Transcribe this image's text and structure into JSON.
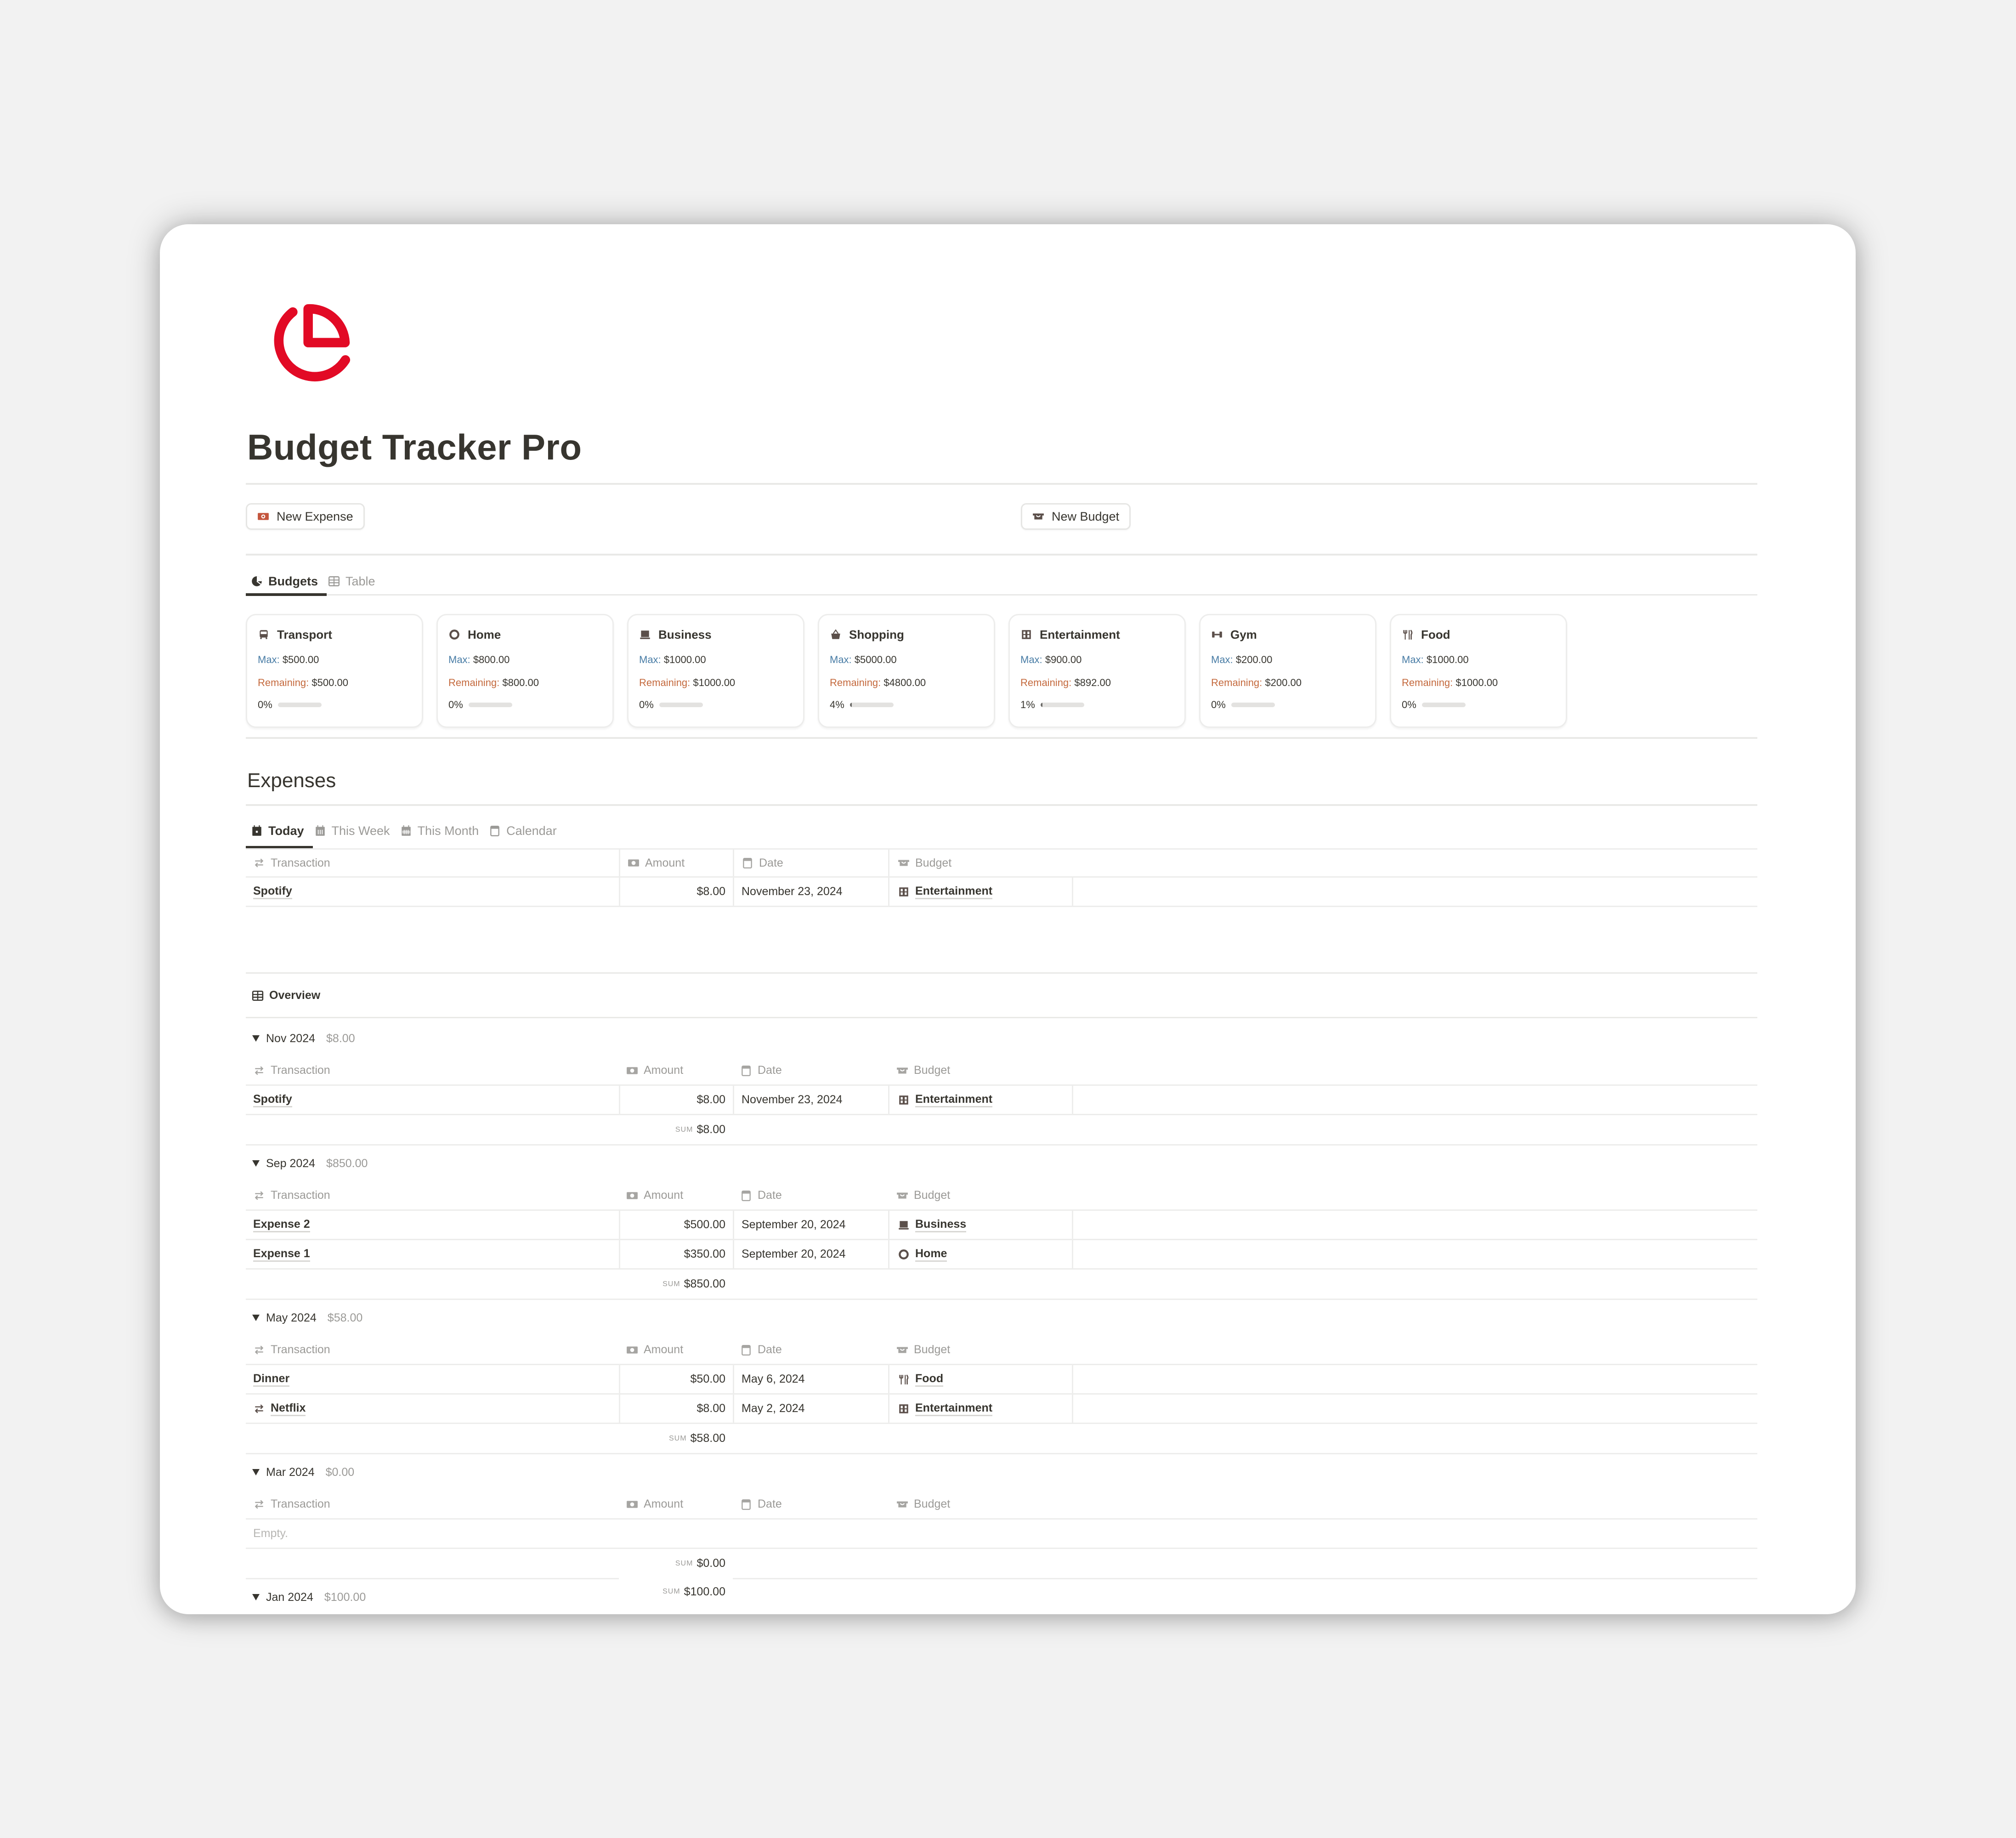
{
  "page": {
    "title": "Budget Tracker Pro",
    "logo_icon": "pie-chart-icon",
    "accent_color": "#E20A25"
  },
  "actions": {
    "new_expense": {
      "label": "New Expense",
      "icon": "money-icon"
    },
    "new_budget": {
      "label": "New Budget",
      "icon": "wallet-icon"
    }
  },
  "budget_tabs": [
    {
      "label": "Budgets",
      "icon": "pie-chart-icon",
      "active": true
    },
    {
      "label": "Table",
      "icon": "table-icon",
      "active": false
    }
  ],
  "budget_labels": {
    "max": "Max:",
    "remaining": "Remaining:"
  },
  "budgets": [
    {
      "name": "Transport",
      "icon": "bus-icon",
      "max": "$500.00",
      "remaining": "$500.00",
      "percent_label": "0%",
      "progress": 0
    },
    {
      "name": "Home",
      "icon": "home-circle-icon",
      "max": "$800.00",
      "remaining": "$800.00",
      "percent_label": "0%",
      "progress": 0
    },
    {
      "name": "Business",
      "icon": "laptop-icon",
      "max": "$1000.00",
      "remaining": "$1000.00",
      "percent_label": "0%",
      "progress": 0
    },
    {
      "name": "Shopping",
      "icon": "basket-icon",
      "max": "$5000.00",
      "remaining": "$4800.00",
      "percent_label": "4%",
      "progress": 0.04
    },
    {
      "name": "Entertainment",
      "icon": "film-icon",
      "max": "$900.00",
      "remaining": "$892.00",
      "percent_label": "1%",
      "progress": 0.01
    },
    {
      "name": "Gym",
      "icon": "dumbbell-icon",
      "max": "$200.00",
      "remaining": "$200.00",
      "percent_label": "0%",
      "progress": 0
    },
    {
      "name": "Food",
      "icon": "utensils-icon",
      "max": "$1000.00",
      "remaining": "$1000.00",
      "percent_label": "0%",
      "progress": 0
    }
  ],
  "expenses": {
    "heading": "Expenses",
    "tabs": [
      {
        "label": "Today",
        "icon": "calendar-day-icon",
        "active": true
      },
      {
        "label": "This Week",
        "icon": "calendar-week-icon",
        "active": false
      },
      {
        "label": "This Month",
        "icon": "calendar-month-icon",
        "active": false
      },
      {
        "label": "Calendar",
        "icon": "calendar-icon",
        "active": false
      }
    ],
    "columns": [
      {
        "label": "Transaction",
        "icon": "arrows-icon"
      },
      {
        "label": "Amount",
        "icon": "money-icon"
      },
      {
        "label": "Date",
        "icon": "calendar-icon"
      },
      {
        "label": "Budget",
        "icon": "wallet-icon"
      }
    ],
    "today_rows": [
      {
        "transaction": "Spotify",
        "amount": "$8.00",
        "date": "November 23, 2024",
        "budget": "Entertainment",
        "budget_icon": "film-icon"
      }
    ]
  },
  "overview": {
    "label": "Overview",
    "icon": "table-icon",
    "sum_label": "SUM",
    "empty_label": "Empty.",
    "groups": [
      {
        "name": "Nov 2024",
        "total": "$8.00",
        "sum": "$8.00",
        "rows": [
          {
            "transaction": "Spotify",
            "amount": "$8.00",
            "date": "November 23, 2024",
            "budget": "Entertainment",
            "budget_icon": "film-icon"
          }
        ]
      },
      {
        "name": "Sep 2024",
        "total": "$850.00",
        "sum": "$850.00",
        "rows": [
          {
            "transaction": "Expense 2",
            "amount": "$500.00",
            "date": "September 20, 2024",
            "budget": "Business",
            "budget_icon": "laptop-icon"
          },
          {
            "transaction": "Expense 1",
            "amount": "$350.00",
            "date": "September 20, 2024",
            "budget": "Home",
            "budget_icon": "home-circle-icon"
          }
        ]
      },
      {
        "name": "May 2024",
        "total": "$58.00",
        "sum": "$58.00",
        "rows": [
          {
            "transaction": "Dinner",
            "amount": "$50.00",
            "date": "May 6, 2024",
            "budget": "Food",
            "budget_icon": "utensils-icon"
          },
          {
            "transaction": "Netflix",
            "amount": "$8.00",
            "date": "May 2, 2024",
            "budget": "Entertainment",
            "budget_icon": "film-icon",
            "transaction_icon": "arrows-icon"
          }
        ]
      },
      {
        "name": "Mar 2024",
        "total": "$0.00",
        "sum": "$0.00",
        "rows": []
      },
      {
        "name": "Jan 2024",
        "total": "$100.00",
        "sum": "$100.00",
        "rows": [],
        "partially_visible": true
      }
    ]
  }
}
